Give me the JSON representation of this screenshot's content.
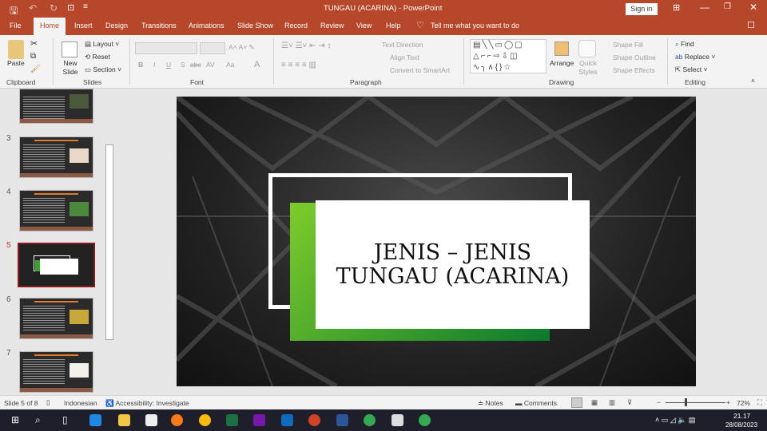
{
  "titlebar": {
    "title": "TUNGAU (ACARINA)  -  PowerPoint",
    "sign_in": "Sign in"
  },
  "tabs": [
    "File",
    "Home",
    "Insert",
    "Design",
    "Transitions",
    "Animations",
    "Slide Show",
    "Record",
    "Review",
    "View",
    "Help"
  ],
  "tell_me": "Tell me what you want to do",
  "ribbon": {
    "clipboard": {
      "label": "Clipboard",
      "paste": "Paste"
    },
    "slides": {
      "label": "Slides",
      "new_slide": "New Slide",
      "layout": "Layout",
      "reset": "Reset",
      "section": "Section"
    },
    "font": {
      "label": "Font",
      "buttons": [
        "B",
        "I",
        "U",
        "S",
        "abc",
        "AV",
        "Aa",
        "A"
      ]
    },
    "paragraph": {
      "label": "Paragraph",
      "text_direction": "Text Direction",
      "align_text": "Align Text",
      "convert": "Convert to SmartArt"
    },
    "drawing": {
      "label": "Drawing",
      "arrange": "Arrange",
      "quick_styles": "Quick Styles",
      "shape_fill": "Shape Fill",
      "shape_outline": "Shape Outline",
      "shape_effects": "Shape Effects"
    },
    "editing": {
      "label": "Editing",
      "find": "Find",
      "replace": "Replace",
      "select": "Select"
    }
  },
  "thumbnails": [
    {
      "num": "3"
    },
    {
      "num": "4"
    },
    {
      "num": "5",
      "selected": true
    },
    {
      "num": "6"
    },
    {
      "num": "7"
    }
  ],
  "slide": {
    "title_line1": "JENIS – JENIS",
    "title_line2": "TUNGAU (ACARINA)"
  },
  "status": {
    "slide": "Slide 5 of 8",
    "language": "Indonesian",
    "accessibility": "Accessibility: Investigate",
    "notes": "Notes",
    "comments": "Comments",
    "zoom": "72%",
    "zoom_fraction": 0.72
  },
  "taskbar": {
    "time": "21.17",
    "date": "28/08/2023"
  },
  "colors": {
    "accent": "#b7472a",
    "green": "#3aa12b"
  }
}
